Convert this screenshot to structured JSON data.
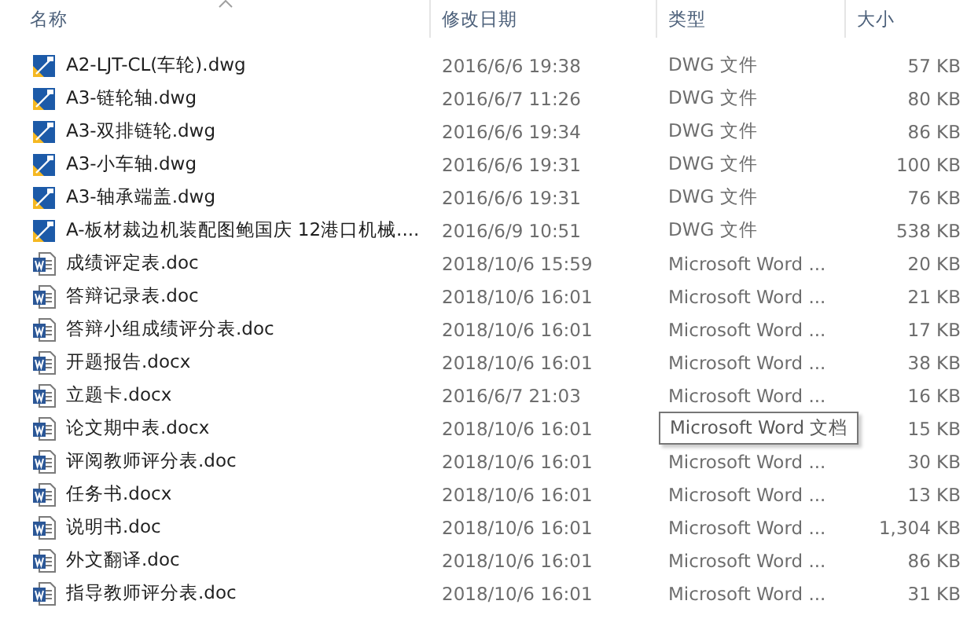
{
  "columns": [
    "名称",
    "修改日期",
    "类型",
    "大小"
  ],
  "rows": [
    {
      "kind": "dwg",
      "name": "A2-LJT-CL(车轮).dwg",
      "date": "2016/6/6 19:38",
      "type": "DWG 文件",
      "size": "57 KB"
    },
    {
      "kind": "dwg",
      "name": "A3-链轮轴.dwg",
      "date": "2016/6/7 11:26",
      "type": "DWG 文件",
      "size": "80 KB"
    },
    {
      "kind": "dwg",
      "name": "A3-双排链轮.dwg",
      "date": "2016/6/6 19:34",
      "type": "DWG 文件",
      "size": "86 KB"
    },
    {
      "kind": "dwg",
      "name": "A3-小车轴.dwg",
      "date": "2016/6/6 19:31",
      "type": "DWG 文件",
      "size": "100 KB"
    },
    {
      "kind": "dwg",
      "name": "A3-轴承端盖.dwg",
      "date": "2016/6/6 19:31",
      "type": "DWG 文件",
      "size": "76 KB"
    },
    {
      "kind": "dwg",
      "name": "A-板材裁边机装配图鲍国庆 12港口机械....",
      "date": "2016/6/9 10:51",
      "type": "DWG 文件",
      "size": "538 KB"
    },
    {
      "kind": "word",
      "name": "成绩评定表.doc",
      "date": "2018/10/6 15:59",
      "type": "Microsoft Word ...",
      "size": "20 KB"
    },
    {
      "kind": "word",
      "name": "答辩记录表.doc",
      "date": "2018/10/6 16:01",
      "type": "Microsoft Word ...",
      "size": "21 KB"
    },
    {
      "kind": "word",
      "name": "答辩小组成绩评分表.doc",
      "date": "2018/10/6 16:01",
      "type": "Microsoft Word ...",
      "size": "17 KB"
    },
    {
      "kind": "word",
      "name": "开题报告.docx",
      "date": "2018/10/6 16:01",
      "type": "Microsoft Word ...",
      "size": "38 KB"
    },
    {
      "kind": "word",
      "name": "立题卡.docx",
      "date": "2016/6/7 21:03",
      "type": "Microsoft Word ...",
      "size": "16 KB"
    },
    {
      "kind": "word",
      "name": "论文期中表.docx",
      "date": "2018/10/6 16:01",
      "size": "15 KB",
      "tooltip": "Microsoft Word 文档"
    },
    {
      "kind": "word",
      "name": "评阅教师评分表.doc",
      "date": "2018/10/6 16:01",
      "type": "Microsoft Word ...",
      "size": "30 KB"
    },
    {
      "kind": "word",
      "name": "任务书.docx",
      "date": "2018/10/6 16:01",
      "type": "Microsoft Word ...",
      "size": "13 KB"
    },
    {
      "kind": "word",
      "name": "说明书.doc",
      "date": "2018/10/6 16:01",
      "type": "Microsoft Word ...",
      "size": "1,304 KB"
    },
    {
      "kind": "word",
      "name": "外文翻译.doc",
      "date": "2018/10/6 16:01",
      "type": "Microsoft Word ...",
      "size": "86 KB"
    },
    {
      "kind": "word",
      "name": "指导教师评分表.doc",
      "date": "2018/10/6 16:01",
      "type": "Microsoft Word ...",
      "size": "31 KB"
    }
  ]
}
